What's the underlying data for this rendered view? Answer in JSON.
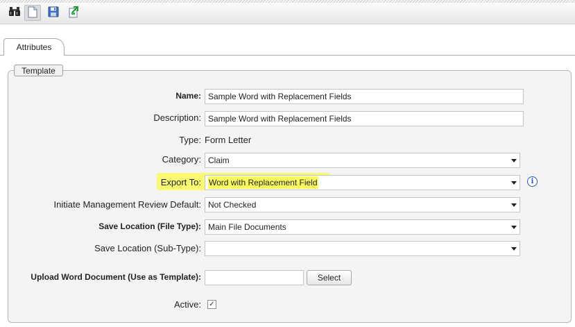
{
  "toolbar": {
    "buttons": [
      {
        "icon": "binoculars-icon"
      },
      {
        "icon": "new-document-icon"
      },
      {
        "icon": "save-icon"
      },
      {
        "icon": "export-icon"
      }
    ]
  },
  "tabs": [
    {
      "label": "Attributes"
    }
  ],
  "section": {
    "legend": "Template"
  },
  "form": {
    "name": {
      "label": "Name:",
      "value": "Sample Word with Replacement Fields"
    },
    "description": {
      "label": "Description:",
      "value": "Sample Word with Replacement Fields"
    },
    "type": {
      "label": "Type:",
      "value": "Form Letter"
    },
    "category": {
      "label": "Category:",
      "value": "Claim"
    },
    "export_to": {
      "label": "Export To:",
      "value": "Word with Replacement Field"
    },
    "mgmt_review": {
      "label": "Initiate Management Review Default:",
      "value": "Not Checked"
    },
    "save_location_type": {
      "label": "Save Location (File Type):",
      "value": "Main File Documents"
    },
    "save_location_subtype": {
      "label": "Save Location (Sub-Type):",
      "value": ""
    },
    "upload": {
      "label": "Upload Word Document (Use as Template):",
      "value": "",
      "button": "Select"
    },
    "active": {
      "label": "Active:",
      "checked": true,
      "check_glyph": "✓"
    }
  },
  "colors": {
    "highlight": "#fafa64",
    "info_icon": "#2a55b5"
  }
}
